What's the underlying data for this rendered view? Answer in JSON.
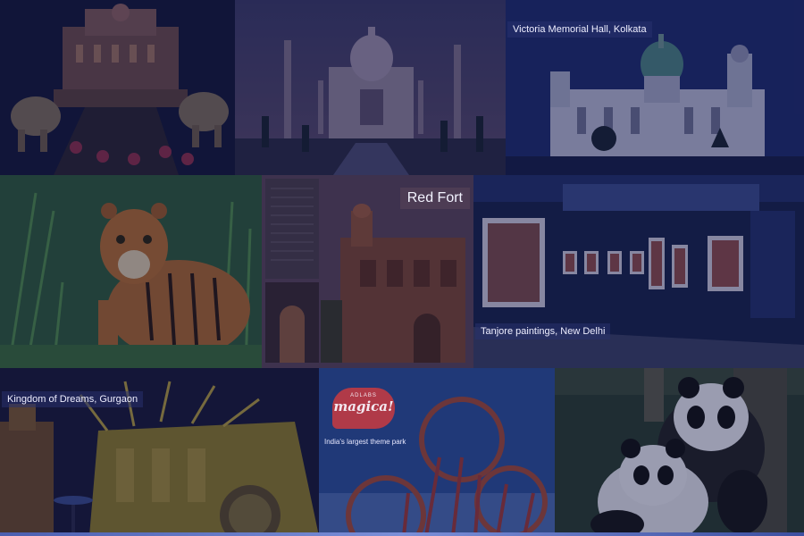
{
  "tiles": [
    {
      "id": "kingdom-palace",
      "caption": ""
    },
    {
      "id": "taj-mahal",
      "caption": ""
    },
    {
      "id": "victoria-memorial",
      "caption": "Victoria Memorial Hall, Kolkata"
    },
    {
      "id": "tiger",
      "caption": ""
    },
    {
      "id": "red-fort",
      "caption": "Red Fort"
    },
    {
      "id": "tanjore-gallery",
      "caption": "Tanjore paintings, New Delhi"
    },
    {
      "id": "kingdom-of-dreams",
      "caption": "Kingdom of Dreams, Gurgaon"
    },
    {
      "id": "adlabs-imagica",
      "caption": "",
      "logo_text": "magica!",
      "logo_small": "ADLABS",
      "tagline": "India's largest theme park"
    },
    {
      "id": "pandas",
      "caption": ""
    }
  ]
}
